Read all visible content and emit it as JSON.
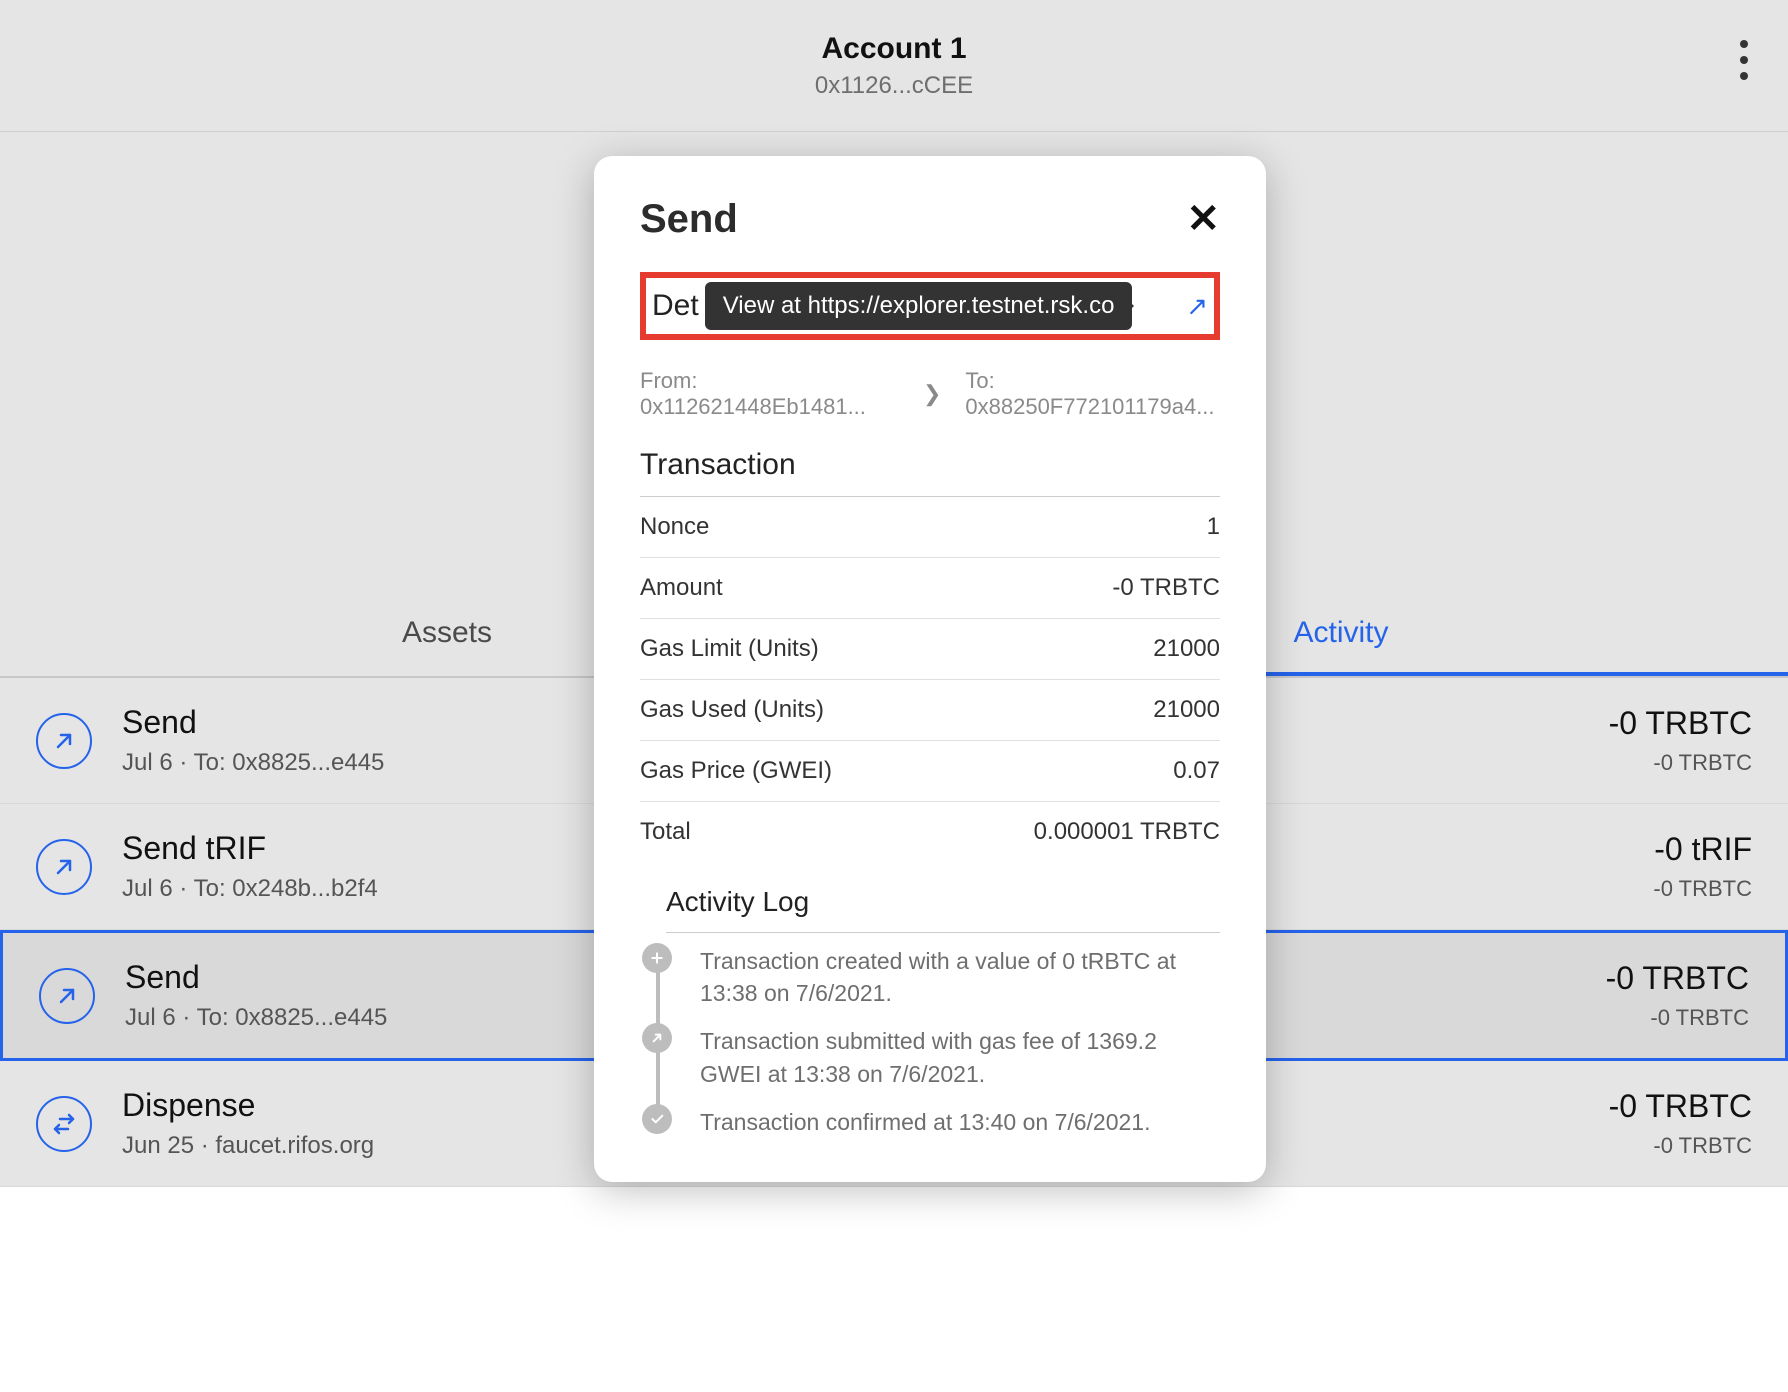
{
  "header": {
    "account_name": "Account 1",
    "address": "0x1126...cCEE"
  },
  "tabs": {
    "assets": "Assets",
    "activity": "Activity"
  },
  "activity": [
    {
      "title": "Send",
      "sub": "Jul 6 · To: 0x8825...e445",
      "amt": "-0 TRBTC",
      "amt2": "-0 TRBTC",
      "icon": "arrow"
    },
    {
      "title": "Send tRIF",
      "sub": "Jul 6 · To: 0x248b...b2f4",
      "amt": "-0 tRIF",
      "amt2": "-0 TRBTC",
      "icon": "arrow"
    },
    {
      "title": "Send",
      "sub": "Jul 6 · To: 0x8825...e445",
      "amt": "-0 TRBTC",
      "amt2": "-0 TRBTC",
      "icon": "arrow",
      "selected": true
    },
    {
      "title": "Dispense",
      "sub": "Jun 25 · faucet.rifos.org",
      "amt": "-0 TRBTC",
      "amt2": "-0 TRBTC",
      "icon": "swap"
    }
  ],
  "modal": {
    "title": "Send",
    "details_label": "Det",
    "tooltip": "View at https://explorer.testnet.rsk.co",
    "from": "From: 0x112621448Eb1481...",
    "to": "To: 0x88250F772101179a4...",
    "tx_title": "Transaction",
    "rows": [
      {
        "k": "Nonce",
        "v": "1"
      },
      {
        "k": "Amount",
        "v": "-0 TRBTC"
      },
      {
        "k": "Gas Limit (Units)",
        "v": "21000"
      },
      {
        "k": "Gas Used (Units)",
        "v": "21000"
      },
      {
        "k": "Gas Price (GWEI)",
        "v": "0.07"
      },
      {
        "k": "Total",
        "v": "0.000001 TRBTC"
      }
    ],
    "log_title": "Activity Log",
    "log": [
      "Transaction created with a value of 0 tRBTC at 13:38 on 7/6/2021.",
      "Transaction submitted with gas fee of 1369.2 GWEI at 13:38 on 7/6/2021.",
      "Transaction confirmed at 13:40 on 7/6/2021."
    ]
  }
}
